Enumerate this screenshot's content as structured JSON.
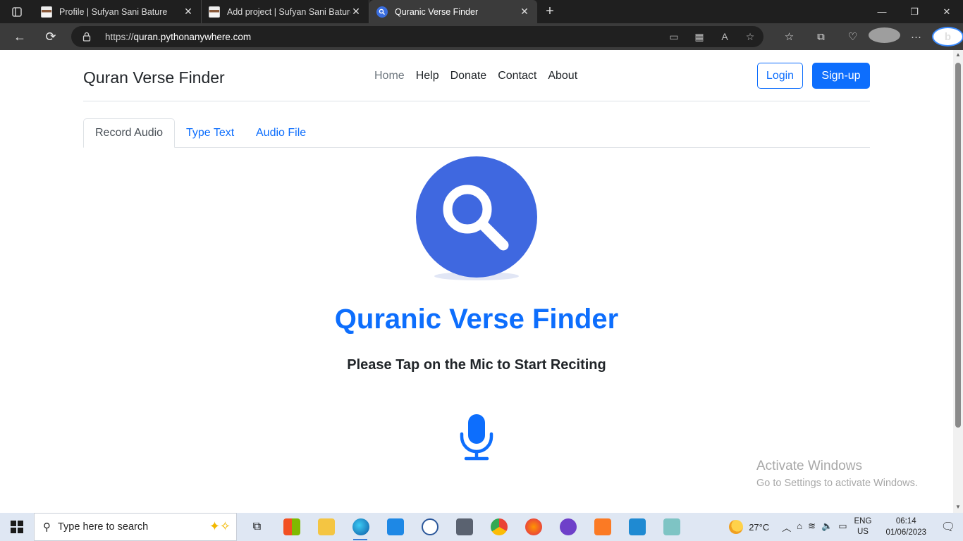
{
  "browser": {
    "tabs": [
      {
        "label": "Profile | Sufyan Sani Bature",
        "active": false
      },
      {
        "label": "Add project | Sufyan Sani Bature",
        "active": false
      },
      {
        "label": "Quranic Verse Finder",
        "active": true
      }
    ],
    "url_prefix": "https://",
    "url_domain": "quran.pythonanywhere.com"
  },
  "site": {
    "brand": "Quran Verse Finder",
    "nav": [
      "Home",
      "Help",
      "Donate",
      "Contact",
      "About"
    ],
    "login_label": "Login",
    "signup_label": "Sign-up",
    "tabs": [
      "Record Audio",
      "Type Text",
      "Audio File"
    ],
    "title": "Quranic Verse Finder",
    "subtitle": "Please Tap on the Mic to Start Reciting"
  },
  "watermark": {
    "line1": "Activate Windows",
    "line2": "Go to Settings to activate Windows."
  },
  "taskbar": {
    "search_placeholder": "Type here to search",
    "temperature": "27°C",
    "lang_top": "ENG",
    "lang_bottom": "US",
    "time": "06:14",
    "date": "01/06/2023"
  },
  "colors": {
    "primary": "#0d6efd",
    "logo_circle": "#3f68e0"
  }
}
